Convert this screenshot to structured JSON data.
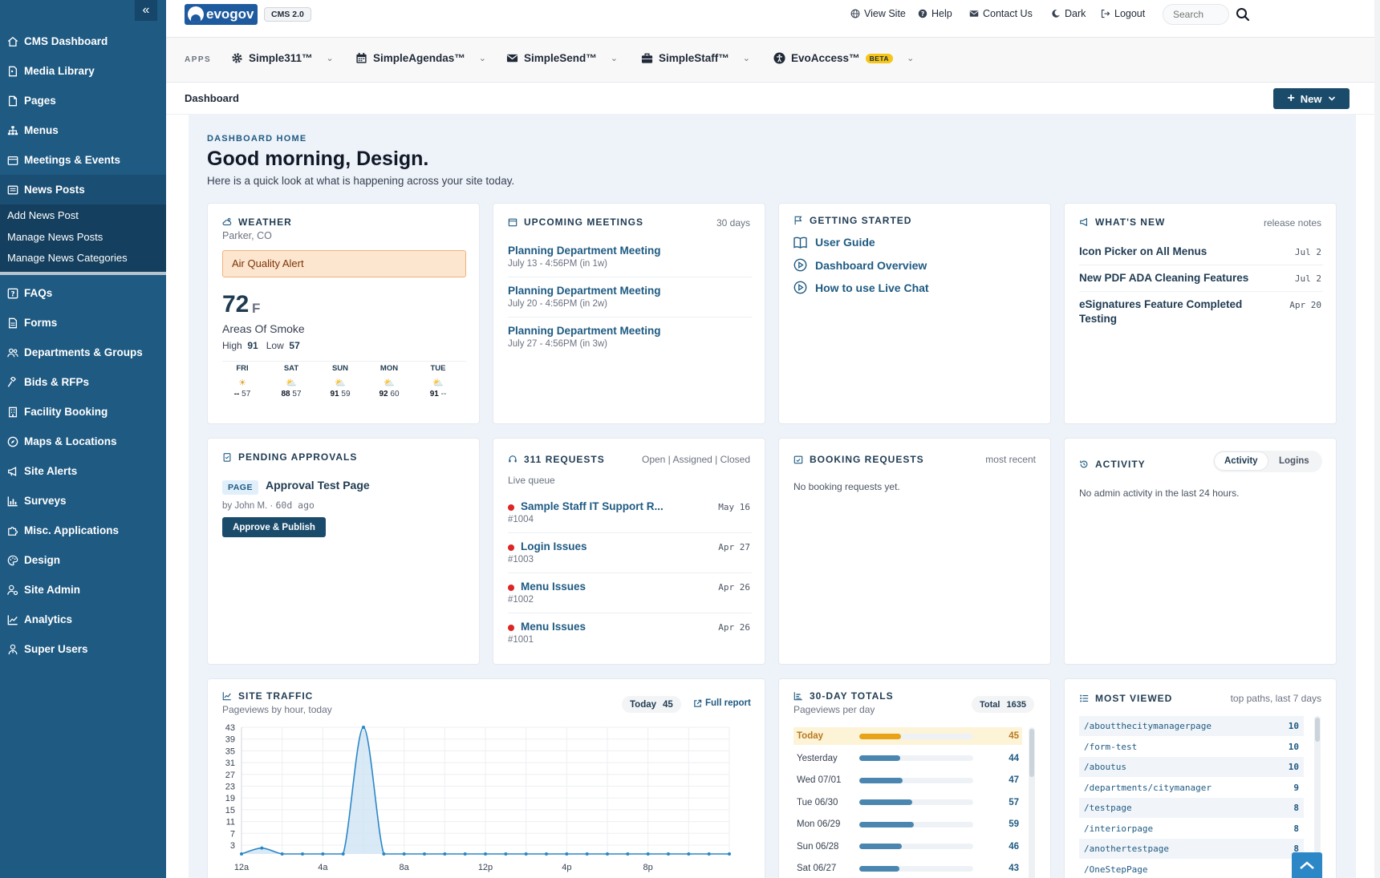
{
  "sidebar": {
    "collapse_icon": "«",
    "items": [
      {
        "label": "CMS Dashboard",
        "icon": "home-icon"
      },
      {
        "label": "Media Library",
        "icon": "file-icon"
      },
      {
        "label": "Pages",
        "icon": "page-icon"
      },
      {
        "label": "Menus",
        "icon": "sitemap-icon"
      },
      {
        "label": "Meetings & Events",
        "icon": "calendar-icon"
      },
      {
        "label": "News Posts",
        "icon": "newspaper-icon"
      },
      {
        "label": "FAQs",
        "icon": "question-icon"
      },
      {
        "label": "Forms",
        "icon": "form-icon"
      },
      {
        "label": "Departments & Groups",
        "icon": "users-icon"
      },
      {
        "label": "Bids & RFPs",
        "icon": "gavel-icon"
      },
      {
        "label": "Facility Booking",
        "icon": "building-icon"
      },
      {
        "label": "Maps & Locations",
        "icon": "compass-icon"
      },
      {
        "label": "Site Alerts",
        "icon": "megaphone-icon"
      },
      {
        "label": "Surveys",
        "icon": "chart-icon"
      },
      {
        "label": "Misc. Applications",
        "icon": "puzzle-icon"
      },
      {
        "label": "Design",
        "icon": "palette-icon"
      },
      {
        "label": "Site Admin",
        "icon": "user-gear-icon"
      },
      {
        "label": "Analytics",
        "icon": "line-chart-icon"
      },
      {
        "label": "Super Users",
        "icon": "user-tie-icon"
      }
    ],
    "subitems": [
      "Add News Post",
      "Manage News Posts",
      "Manage News Categories"
    ]
  },
  "topbar": {
    "logo_text": "evogov",
    "cms_badge": "CMS 2.0",
    "links": [
      "View Site",
      "Help",
      "Contact Us",
      "Dark",
      "Logout"
    ],
    "search_placeholder": "Search"
  },
  "apps": {
    "label": "APPS",
    "items": [
      {
        "label": "Simple311™",
        "icon": "gear-icon"
      },
      {
        "label": "SimpleAgendas™",
        "icon": "calendar-icon"
      },
      {
        "label": "SimpleSend™",
        "icon": "envelope-icon"
      },
      {
        "label": "SimpleStaff™",
        "icon": "briefcase-icon"
      },
      {
        "label": "EvoAccess™",
        "icon": "accessibility-icon",
        "badge": "BETA"
      }
    ]
  },
  "breadcrumb": {
    "current": "Dashboard",
    "new_button": "New"
  },
  "hero": {
    "eyebrow": "DASHBOARD HOME",
    "greeting": "Good morning, Design.",
    "subtitle": "Here is a quick look at what is happening across your site today."
  },
  "weather": {
    "title": "WEATHER",
    "location": "Parker, CO",
    "alert": "Air Quality Alert",
    "temp": "72",
    "unit": "F",
    "condition": "Areas Of Smoke",
    "high_label": "High",
    "high": "91",
    "low_label": "Low",
    "low": "57",
    "forecast": [
      {
        "day": "FRI",
        "icon": "☀",
        "hi": "--",
        "lo": "57"
      },
      {
        "day": "SAT",
        "icon": "⛅",
        "hi": "88",
        "lo": "57"
      },
      {
        "day": "SUN",
        "icon": "⛅",
        "hi": "91",
        "lo": "59"
      },
      {
        "day": "MON",
        "icon": "⛅",
        "hi": "92",
        "lo": "60"
      },
      {
        "day": "TUE",
        "icon": "⛅",
        "hi": "91",
        "lo": "--"
      }
    ]
  },
  "meetings": {
    "title": "UPCOMING MEETINGS",
    "meta": "30 days",
    "items": [
      {
        "name": "Planning Department Meeting",
        "when": "July 13 - 4:56PM (in 1w)"
      },
      {
        "name": "Planning Department Meeting",
        "when": "July 20 - 4:56PM (in 2w)"
      },
      {
        "name": "Planning Department Meeting",
        "when": "July 27 - 4:56PM (in 3w)"
      }
    ]
  },
  "getting_started": {
    "title": "GETTING STARTED",
    "items": [
      {
        "label": "User Guide",
        "icon": "book-icon"
      },
      {
        "label": "Dashboard Overview",
        "icon": "play-icon"
      },
      {
        "label": "How to use Live Chat",
        "icon": "play-icon"
      }
    ]
  },
  "whats_new": {
    "title": "WHAT'S NEW",
    "meta": "release notes",
    "items": [
      {
        "label": "Icon Picker on All Menus",
        "date": "Jul 2"
      },
      {
        "label": "New PDF ADA Cleaning Features",
        "date": "Jul 2"
      },
      {
        "label": "eSignatures Feature Completed Testing",
        "date": "Apr 20"
      }
    ]
  },
  "approvals": {
    "title": "PENDING APPROVALS",
    "badge": "PAGE",
    "item": "Approval Test Page",
    "by": "by John M.",
    "age": "60d ago",
    "button": "Approve & Publish"
  },
  "requests": {
    "title": "311 REQUESTS",
    "filters": [
      "Open",
      "Assigned",
      "Closed"
    ],
    "queue": "Live queue",
    "items": [
      {
        "name": "Sample Staff IT Support R...",
        "id": "#1004",
        "date": "May 16"
      },
      {
        "name": "Login Issues",
        "id": "#1003",
        "date": "Apr 27"
      },
      {
        "name": "Menu Issues",
        "id": "#1002",
        "date": "Apr 26"
      },
      {
        "name": "Menu Issues",
        "id": "#1001",
        "date": "Apr 26"
      }
    ]
  },
  "booking": {
    "title": "BOOKING REQUESTS",
    "meta": "most recent",
    "empty": "No booking requests yet."
  },
  "activity": {
    "title": "ACTIVITY",
    "tabs": [
      "Activity",
      "Logins"
    ],
    "empty": "No admin activity in the last 24 hours."
  },
  "traffic": {
    "title": "SITE TRAFFIC",
    "subtitle": "Pageviews by hour, today",
    "today_label": "Today",
    "today_value": "45",
    "full_report": "Full report"
  },
  "totals": {
    "title": "30-DAY TOTALS",
    "subtitle": "Pageviews per day",
    "total_label": "Total",
    "total_value": "1635",
    "rows": [
      {
        "label": "Today",
        "value": 45,
        "highlight": true
      },
      {
        "label": "Yesterday",
        "value": 44
      },
      {
        "label": "Wed 07/01",
        "value": 47
      },
      {
        "label": "Tue 06/30",
        "value": 57
      },
      {
        "label": "Mon 06/29",
        "value": 59
      },
      {
        "label": "Sun 06/28",
        "value": 46
      },
      {
        "label": "Sat 06/27",
        "value": 43
      }
    ]
  },
  "most_viewed": {
    "title": "MOST VIEWED",
    "meta": "top paths, last 7 days",
    "rows": [
      {
        "path": "/aboutthecitymanagerpage",
        "count": "10"
      },
      {
        "path": "/form-test",
        "count": "10"
      },
      {
        "path": "/aboutus",
        "count": "10"
      },
      {
        "path": "/departments/citymanager",
        "count": "9"
      },
      {
        "path": "/testpage",
        "count": "8"
      },
      {
        "path": "/interiorpage",
        "count": "8"
      },
      {
        "path": "/anothertestpage",
        "count": "8"
      },
      {
        "path": "/OneStepPage",
        "count": ""
      }
    ]
  },
  "chart_data": {
    "type": "area",
    "x": [
      "12a",
      "1a",
      "2a",
      "3a",
      "4a",
      "5a",
      "6a",
      "7a",
      "8a",
      "9a",
      "10a",
      "11a",
      "12p",
      "1p",
      "2p",
      "3p",
      "4p",
      "5p",
      "6p",
      "7p",
      "8p",
      "9p",
      "10p",
      "11p",
      "12a"
    ],
    "x_tick_labels": [
      "12a",
      "4a",
      "8a",
      "12p",
      "4p",
      "8p"
    ],
    "y_tick_labels": [
      "3",
      "7",
      "11",
      "15",
      "19",
      "23",
      "27",
      "31",
      "35",
      "39",
      "43"
    ],
    "series": [
      {
        "values": [
          0,
          2,
          0,
          0,
          0,
          0,
          43,
          0,
          0,
          0,
          0,
          0,
          0,
          0,
          0,
          0,
          0,
          0,
          0,
          0,
          0,
          0,
          0,
          0,
          0
        ]
      }
    ],
    "ylim": [
      0,
      43
    ],
    "grid": true,
    "colors": {
      "line": "#2b87c6",
      "fill": "#cfe3f4"
    }
  },
  "theme": {
    "sidebar": "#1e5a82",
    "accent": "#1e5a82",
    "alert_bg": "#fde6cf",
    "bar_today": "#e8a317"
  }
}
